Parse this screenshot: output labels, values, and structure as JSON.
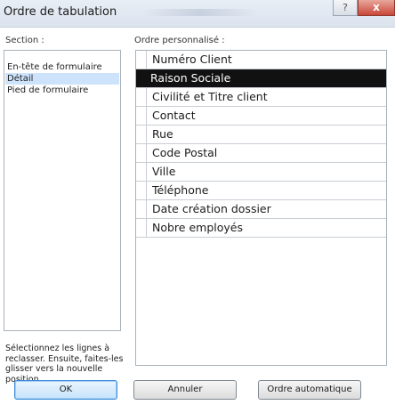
{
  "window": {
    "title": "Ordre de tabulation",
    "help_glyph": "?",
    "close_glyph": "x"
  },
  "section": {
    "label": "Section :",
    "items": [
      {
        "label": "En-tête de formulaire",
        "selected": false
      },
      {
        "label": "Détail",
        "selected": true
      },
      {
        "label": "Pied de formulaire",
        "selected": false
      }
    ]
  },
  "custom_order": {
    "label": "Ordre personnalisé :",
    "rows": [
      {
        "label": "Numéro Client",
        "selected": false
      },
      {
        "label": "Raison Sociale",
        "selected": true
      },
      {
        "label": "Civilité et Titre client",
        "selected": false
      },
      {
        "label": "Contact",
        "selected": false
      },
      {
        "label": "Rue",
        "selected": false
      },
      {
        "label": "Code Postal",
        "selected": false
      },
      {
        "label": "Ville",
        "selected": false
      },
      {
        "label": "Téléphone",
        "selected": false
      },
      {
        "label": "Date création dossier",
        "selected": false
      },
      {
        "label": "Nobre employés",
        "selected": false
      }
    ]
  },
  "hint": "Sélectionnez les lignes à reclasser. Ensuite, faites-les glisser vers la nouvelle position.",
  "buttons": {
    "ok": "OK",
    "cancel": "Annuler",
    "auto_order": "Ordre automatique"
  },
  "colors": {
    "selected_row_bg": "#111111",
    "selected_section_bg": "#cde3fb",
    "default_button_border": "#3d8bd8"
  }
}
